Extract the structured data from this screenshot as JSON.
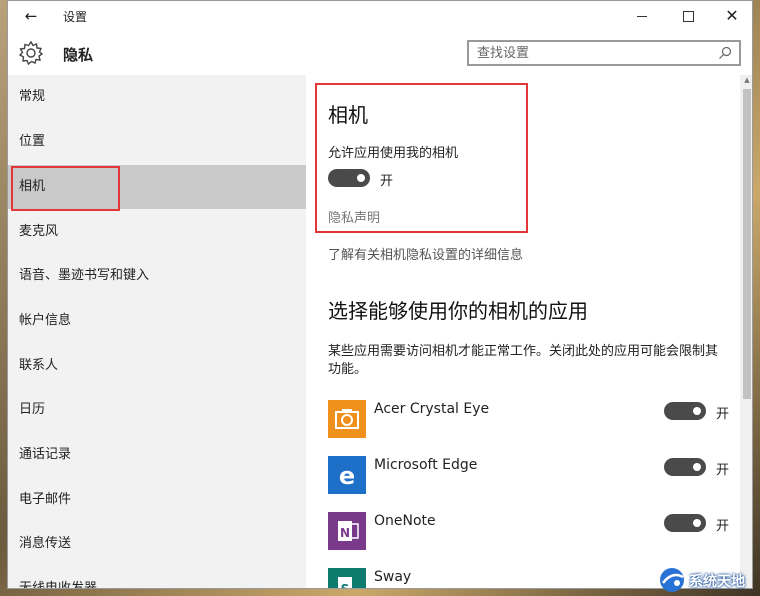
{
  "window": {
    "title": "设置",
    "back_glyph": "←",
    "close_glyph": "✕"
  },
  "header": {
    "title": "隐私",
    "search_placeholder": "查找设置"
  },
  "sidebar": {
    "items": [
      {
        "label": "常规"
      },
      {
        "label": "位置"
      },
      {
        "label": "相机",
        "active": true
      },
      {
        "label": "麦克风"
      },
      {
        "label": "语音、墨迹书写和键入"
      },
      {
        "label": "帐户信息"
      },
      {
        "label": "联系人"
      },
      {
        "label": "日历"
      },
      {
        "label": "通话记录"
      },
      {
        "label": "电子邮件"
      },
      {
        "label": "消息传送"
      },
      {
        "label": "无线电收发器"
      }
    ]
  },
  "main": {
    "section_title": "相机",
    "allow_label": "允许应用使用我的相机",
    "master_toggle": {
      "state_label": "开",
      "on": true
    },
    "privacy_statement": "隐私声明",
    "learn_more": "了解有关相机隐私设置的详细信息",
    "apps_title": "选择能够使用你的相机的应用",
    "apps_desc": "某些应用需要访问相机才能正常工作。关闭此处的应用可能会限制其功能。",
    "apps": [
      {
        "name": "Acer Crystal Eye",
        "toggle_label": "开",
        "on": true,
        "icon": "camera-app-icon",
        "color": "#f0901c"
      },
      {
        "name": "Microsoft Edge",
        "toggle_label": "开",
        "on": true,
        "icon": "edge-icon",
        "color": "#1e6fc7"
      },
      {
        "name": "OneNote",
        "toggle_label": "开",
        "on": true,
        "icon": "onenote-icon",
        "color": "#7a3a8c"
      },
      {
        "name": "Sway",
        "toggle_label": "",
        "on": true,
        "icon": "sway-icon",
        "color": "#0f7a6e"
      }
    ]
  },
  "watermark": {
    "text": "系统天地"
  },
  "colors": {
    "sidebar_bg": "#f2f2f2",
    "active_item": "#c9c9c9",
    "toggle_on": "#4a4a4a",
    "highlight_border": "#e23838"
  }
}
